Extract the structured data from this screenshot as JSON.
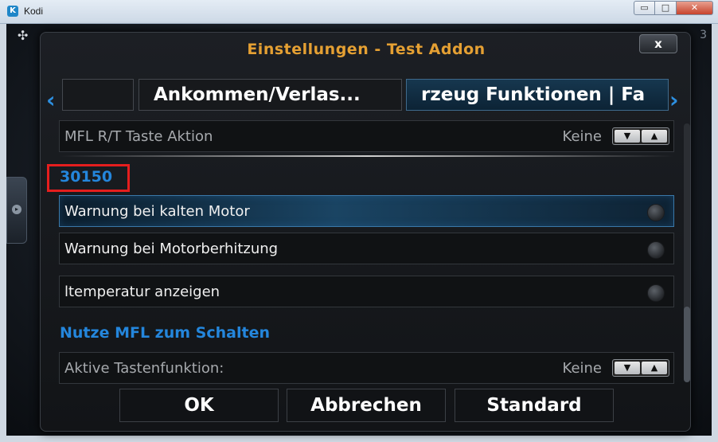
{
  "window": {
    "title": "Kodi",
    "app_icon": "kodi-icon",
    "buttons": {
      "minimize": "▭",
      "maximize": "□",
      "close": "✕"
    }
  },
  "background": {
    "puzzle_icon": "puzzle-icon",
    "corner_digit": "3"
  },
  "dialog": {
    "title": "Einstellungen - Test Addon",
    "close_label": "x",
    "tabs": [
      {
        "label": ""
      },
      {
        "label": "Ankommen/Verlas..."
      },
      {
        "label": "rzeug Funktionen | Fa"
      }
    ],
    "nav": {
      "left": "‹",
      "right": "›"
    }
  },
  "settings": {
    "row_mfl_rt": {
      "label": "MFL R/T Taste Aktion",
      "value": "Keine"
    },
    "section_1": "30150",
    "row_cold": {
      "label": "Warnung bei kalten Motor"
    },
    "row_overheat": {
      "label": "Warnung bei Motorberhitzung"
    },
    "row_temp": {
      "label": "ltemperatur anzeigen"
    },
    "section_2": "Nutze MFL zum Schalten",
    "row_key": {
      "label": "Aktive Tastenfunktion:",
      "value": "Keine"
    },
    "spinner": {
      "down": "▼",
      "up": "▲"
    }
  },
  "footer": {
    "ok": "OK",
    "cancel": "Abbrechen",
    "default": "Standard"
  },
  "colors": {
    "accent": "#2486dc",
    "title": "#e5a033",
    "highlight": "#e51e1e"
  }
}
